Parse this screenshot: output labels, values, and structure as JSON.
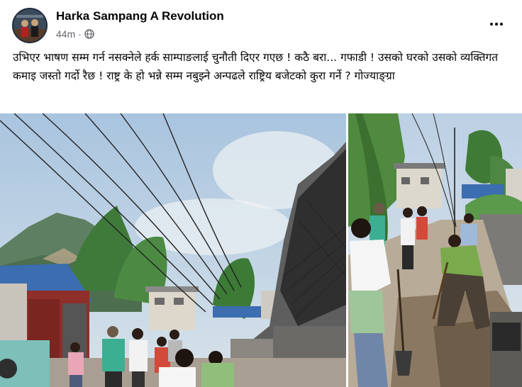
{
  "post": {
    "author": "Harka Sampang A Revolution",
    "timestamp": "44m",
    "separator": "·",
    "privacy_icon": "globe-icon",
    "menu_icon": "more-options-icon",
    "text": "उभिएर भाषण सम्म गर्न नसक्नेले हर्क साम्पाङलाई चुनौती दिएर गएछ ! कठै बरा... गफाडी ! उसको घरको उसको व्यक्तिगत कमाइ जस्तो गर्दो रैछ ! राष्ट्र के हो भन्ने सम्म नबुझ्ने अन्पढले राष्ट्रिय बजेटको कुरा गर्ने ? गोज्याङ्ग्रा"
  },
  "colors": {
    "author_text": "#050505",
    "meta_text": "#65676b",
    "background": "#ffffff"
  }
}
